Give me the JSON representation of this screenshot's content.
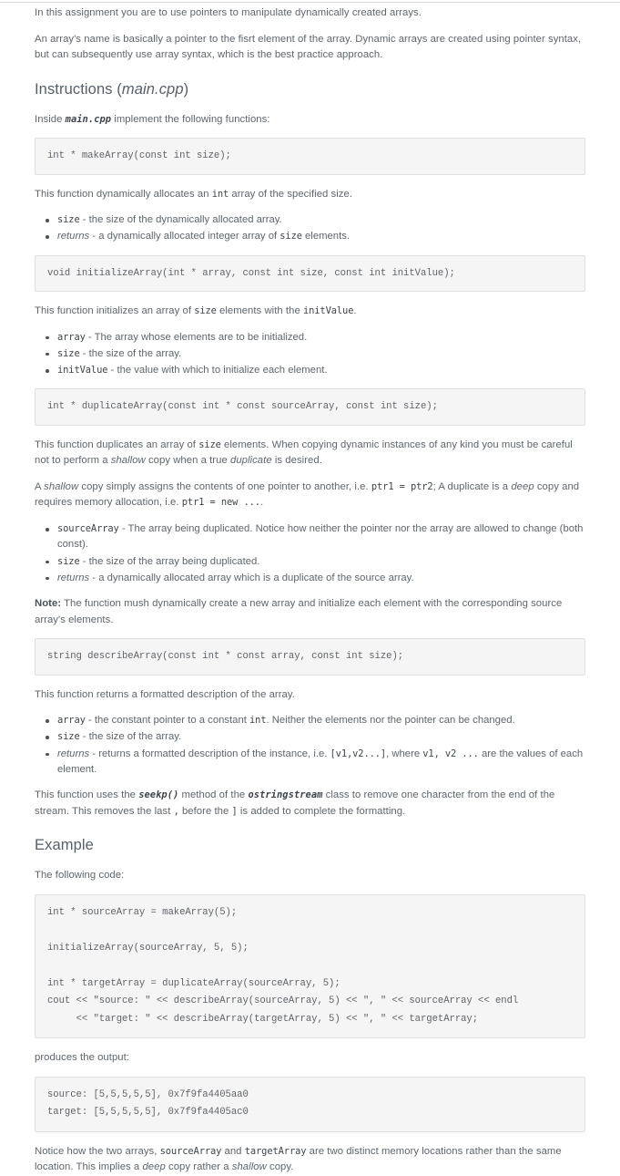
{
  "document": {
    "intro": {
      "p1": "In this assignment you are to use pointers to manipulate dynamically created arrays.",
      "p2": "An array's name is basically a pointer to the fisrt element of the array. Dynamic arrays are created using pointer syntax, but can subsequently use array syntax, which is the best practice approach."
    },
    "instructions": {
      "heading_prefix": "Instructions (",
      "heading_file": "main.cpp",
      "heading_suffix": ")",
      "lead_prefix": "Inside ",
      "lead_code": "main.cpp",
      "lead_suffix": " implement the following functions:"
    },
    "make_array": {
      "signature": "int * makeArray(const int size);",
      "desc_pre": "This function dynamically allocates an ",
      "desc_code": "int",
      "desc_post": " array of the specified size.",
      "bullets": [
        {
          "term": "size",
          "term_style": "code",
          "text": " - the size of the dynamically allocated array."
        },
        {
          "term": "returns",
          "term_style": "italic",
          "text_pre": " - a dynamically allocated integer array of ",
          "text_code": "size",
          "text_post": " elements."
        }
      ]
    },
    "initialize_array": {
      "signature": "void initializeArray(int * array, const int size, const int initValue);",
      "desc_pre": "This function initializes an array of ",
      "desc_code1": "size",
      "desc_mid": " elements with the ",
      "desc_code2": "initValue",
      "desc_post": ".",
      "bullets": [
        {
          "term": "array",
          "text": " - The array whose elements are to be initialized."
        },
        {
          "term": "size",
          "text": " - the size of the array."
        },
        {
          "term": "initValue",
          "text": " - the value with which to initialize each element."
        }
      ]
    },
    "duplicate_array": {
      "signature": "int * duplicateArray(const int * const sourceArray, const int size);",
      "desc_pre": "This function duplicates an array of ",
      "desc_code": "size",
      "desc_mid": " elements. When copying dynamic instances of any kind you must be careful not to perform a ",
      "desc_it1": "shallow",
      "desc_mid2": " copy when a true ",
      "desc_it2": "duplicate",
      "desc_post": " is desired.",
      "shallow_p": {
        "a": "A ",
        "it1": "shallow",
        "b": " copy simply assigns the contents of one pointer to another, i.e. ",
        "code1": "ptr1 = ptr2",
        "c": "; A duplicate is a ",
        "it2": "deep",
        "d": " copy and requires memory allocation, i.e. ",
        "code2": "ptr1 = new ...",
        "e": "."
      },
      "bullets": [
        {
          "term": "sourceArray",
          "text": " - The array being duplicated. Notice how neither the pointer nor the array are allowed to change (both const)."
        },
        {
          "term": "size",
          "text": " - the size of the array being duplicated."
        },
        {
          "term": "returns",
          "term_style": "italic",
          "text": " - a dynamically allocated array which is a duplicate of the source array."
        }
      ],
      "note_label": "Note:",
      "note_text": " The function mush dynamically create a new array and initialize each element with the corresponding source array's elements."
    },
    "describe_array": {
      "signature": "string describeArray(const int * const array, const int size);",
      "desc": "This function returns a formatted description of the array.",
      "bullets": [
        {
          "term": "array",
          "text_pre": " - the constant pointer to a constant ",
          "text_code": "int",
          "text_post": ". Neither the elements nor the pointer can be changed."
        },
        {
          "term": "size",
          "text": " - the size of the array."
        },
        {
          "term": "returns",
          "term_style": "italic",
          "text_pre": " - returns a formatted description of the instance, i.e. ",
          "text_code": "[v1,v2...]",
          "text_mid": ", where ",
          "text_code2": "v1, v2 ...",
          "text_post": " are the values of each element."
        }
      ],
      "seekp_p": {
        "a": "This function uses the ",
        "code1": "seekp()",
        "b": " method of the ",
        "code2": "ostringstream",
        "c": " class to remove one character from the end of the stream. This removes the last ",
        "code3": ",",
        "d": " before the ",
        "code4": "]",
        "e": " is added to complete the formatting."
      }
    },
    "example": {
      "heading": "Example",
      "lead": "The following code:",
      "code": "int * sourceArray = makeArray(5);\n\ninitializeArray(sourceArray, 5, 5);\n\nint * targetArray = duplicateArray(sourceArray, 5);\ncout << \"source: \" << describeArray(sourceArray, 5) << \", \" << sourceArray << endl\n     << \"target: \" << describeArray(targetArray, 5) << \", \" << targetArray;",
      "produces_label": "produces the output:",
      "output": "source: [5,5,5,5,5], 0x7f9fa4405aa0\ntarget: [5,5,5,5,5], 0x7f9fa4405ac0",
      "closing": {
        "a": "Notice how the two arrays, ",
        "code1": "sourceArray",
        "b": " and ",
        "code2": "targetArray",
        "c": " are two distinct memory locations rather than the same location. This implies a ",
        "it1": "deep",
        "d": " copy rather a ",
        "it2": "shallow",
        "e": " copy."
      }
    }
  }
}
